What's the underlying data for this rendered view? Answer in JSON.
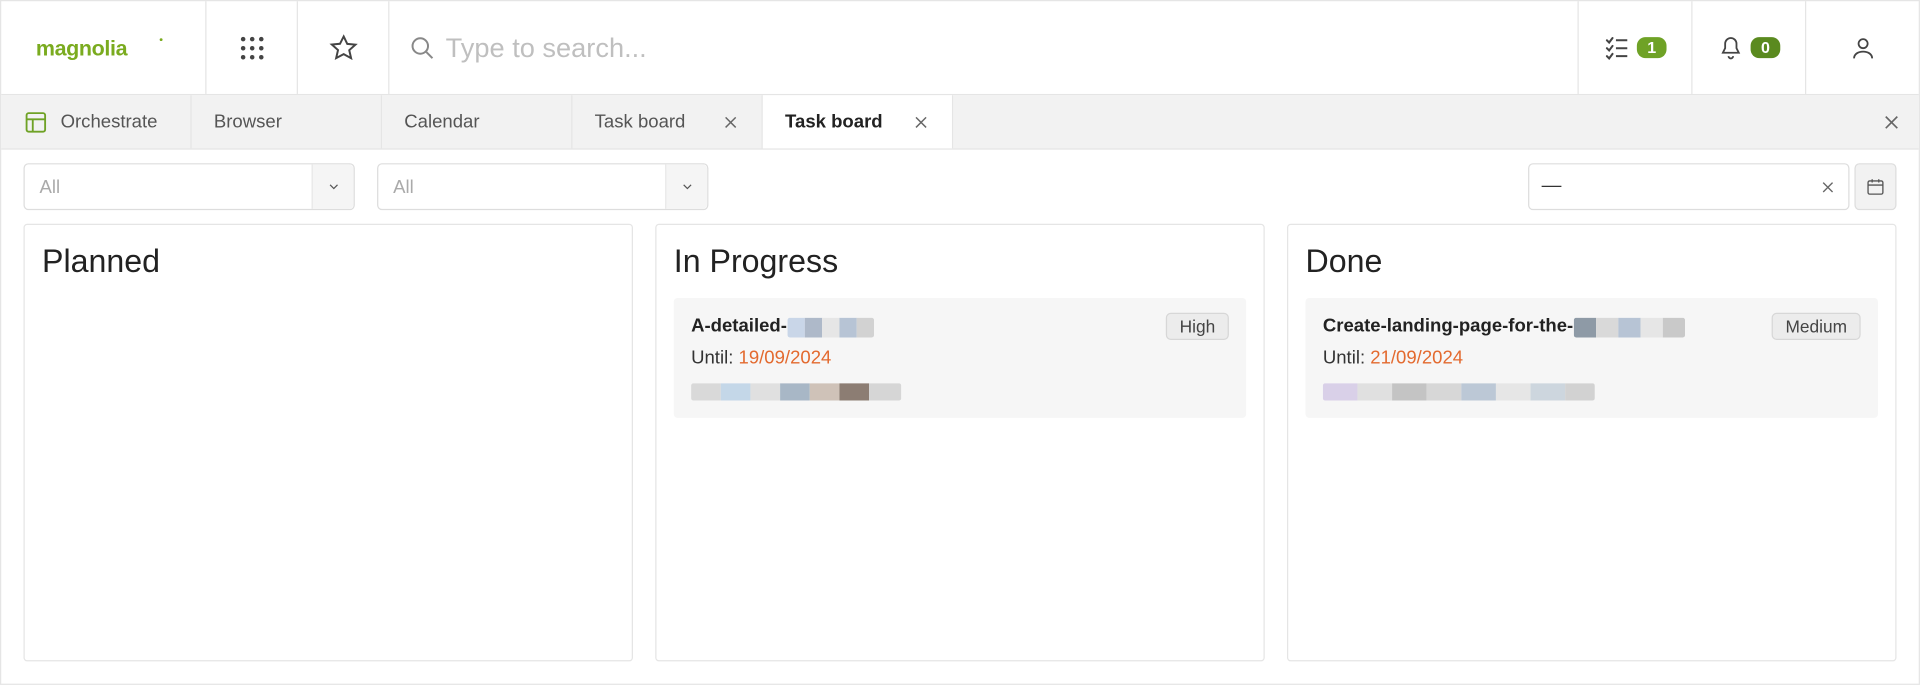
{
  "header": {
    "logo_text": "magnolia",
    "search_placeholder": "Type to search...",
    "tasks_badge": "1",
    "notifications_badge": "0"
  },
  "tabs": {
    "app_label": "Orchestrate",
    "items": [
      {
        "label": "Browser",
        "closable": false
      },
      {
        "label": "Calendar",
        "closable": false
      },
      {
        "label": "Task board",
        "closable": true
      },
      {
        "label": "Task board",
        "closable": true,
        "active": true
      }
    ]
  },
  "filters": {
    "select1": "All",
    "select2": "All",
    "date_value": "—"
  },
  "board": {
    "columns": [
      {
        "title": "Planned",
        "cards": []
      },
      {
        "title": "In Progress",
        "cards": [
          {
            "title_prefix": "A-detailed-",
            "priority": "High",
            "until_label": "Until:",
            "until_date": "19/09/2024"
          }
        ]
      },
      {
        "title": "Done",
        "cards": [
          {
            "title_prefix": "Create-landing-page-for-the-",
            "priority": "Medium",
            "until_label": "Until:",
            "until_date": "21/09/2024"
          }
        ]
      }
    ]
  }
}
